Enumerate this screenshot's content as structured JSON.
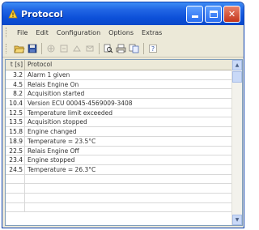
{
  "window": {
    "title": "Protocol",
    "title_icon": "warning-triangle-icon"
  },
  "menubar": {
    "items": [
      "File",
      "Edit",
      "Configuration",
      "Options",
      "Extras"
    ]
  },
  "toolbar": {
    "icons": [
      "open-folder-icon",
      "save-icon",
      "disabled-tool-icon",
      "disabled-tool-icon",
      "disabled-tool-icon",
      "disabled-tool-icon",
      "print-preview-icon",
      "print-icon",
      "copy-icon",
      "help-icon"
    ]
  },
  "table": {
    "headers": {
      "time": "t [s]",
      "text": "Protocol"
    },
    "rows": [
      {
        "time": "3.2",
        "text": "Alarm 1 given"
      },
      {
        "time": "4.5",
        "text": "Relais Engine On"
      },
      {
        "time": "8.2",
        "text": "Acquisition started"
      },
      {
        "time": "10.4",
        "text": "Version ECU 00045-4569009-3408"
      },
      {
        "time": "12.5",
        "text": "Temperature limit exceeded"
      },
      {
        "time": "13.5",
        "text": "Acquisition stopped"
      },
      {
        "time": "15.8",
        "text": "Engine changed"
      },
      {
        "time": "18.9",
        "text": "Temperature = 23.5°C"
      },
      {
        "time": "22.5",
        "text": "Relais Engine Off"
      },
      {
        "time": "23.4",
        "text": "Engine stopped"
      },
      {
        "time": "24.5",
        "text": "Temperature = 26.3°C"
      },
      {
        "time": "",
        "text": ""
      },
      {
        "time": "",
        "text": ""
      },
      {
        "time": "",
        "text": ""
      },
      {
        "time": "",
        "text": ""
      }
    ]
  },
  "colors": {
    "titlebar": "#0c4fd8",
    "window_bg": "#ece9d8",
    "close_button": "#c4351b"
  }
}
